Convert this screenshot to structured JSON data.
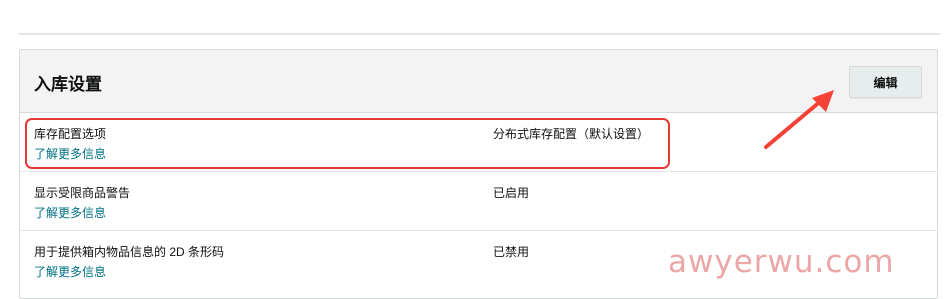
{
  "section": {
    "title": "入库设置",
    "edit_label": "编辑"
  },
  "rows": [
    {
      "label": "库存配置选项",
      "link": "了解更多信息",
      "value": "分布式库存配置（默认设置）"
    },
    {
      "label": "显示受限商品警告",
      "link": "了解更多信息",
      "value": "已启用"
    },
    {
      "label": "用于提供箱内物品信息的 2D 条形码",
      "link": "了解更多信息",
      "value": "已禁用"
    }
  ],
  "annotations": {
    "highlight_color": "#e53935",
    "arrow_color": "#f44336"
  },
  "watermark": "awyerwu.com",
  "colors": {
    "link": "#007185",
    "header_bg": "#f3f3f3",
    "button_bg": "#e7eded",
    "border": "#d5d9d9"
  }
}
